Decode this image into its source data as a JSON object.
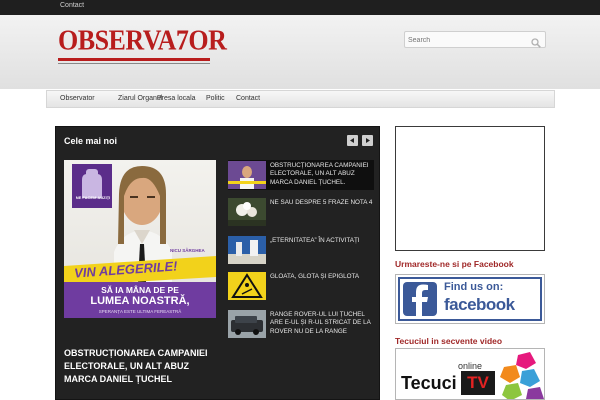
{
  "topbar": {
    "link": "Contact"
  },
  "brand": {
    "logo_text": "OBSERVA7OR"
  },
  "search": {
    "placeholder": "Search"
  },
  "nav": [
    "Observator",
    "Ziarul Organul",
    "Presa locala",
    "Politic",
    "Contact"
  ],
  "latest": {
    "title": "Cele mai noi",
    "feature": {
      "headline": "OBSTRUCȚIONAREA CAMPANIEI ELECTORALE, UN ALT ABUZ MARCA DANIEL ȚUCHEL",
      "poster": {
        "badge": "NE FACEM AUZIȚI",
        "name": "NICU SÂRGHEA",
        "banner": "VIN ALEGERILE!",
        "line1": "SĂ IA MÂNA DE PE",
        "line2": "LUMEA NOASTRĂ,",
        "line3": "SPERANȚA ESTE ULTIMA FEREASTRĂ"
      }
    },
    "items": [
      {
        "text": "OBSTRUCȚIONAREA CAMPANIEI ELECTORALE, UN ALT ABUZ MARCA DANIEL ȚUCHEL.",
        "thumb": "poster"
      },
      {
        "text": "NE SAU DESPRE 5 FRAZE NOTA 4",
        "thumb": "flowers"
      },
      {
        "text": "„Eternitatea” în activitați",
        "thumb": "blue"
      },
      {
        "text": "GLOATA, GLOTA ȘI EPIGLOTA",
        "thumb": "sign"
      },
      {
        "text": "RANGE ROVER-UL LUI ȚUCHEL ARE E-UL ȘI R-UL STRICAT DE LA ROVER NU DE LA RANGE",
        "thumb": "car"
      }
    ]
  },
  "sidebar": {
    "facebook_title": "Urmareste-ne si pe Facebook",
    "facebook_banner": {
      "line1": "Find us on:",
      "line2": "facebook"
    },
    "video_title": "Tecuciul in secvente video",
    "tv_banner": {
      "tag": "online",
      "word": "Tecuci",
      "tv": "TV"
    }
  },
  "colors": {
    "brand_red": "#b81d1d",
    "sidebar_title": "#a02828",
    "facebook_blue": "#3b5998",
    "dark_panel": "#222222",
    "banner_yellow": "#f2d21b",
    "banner_purple": "#6f3ca0"
  }
}
